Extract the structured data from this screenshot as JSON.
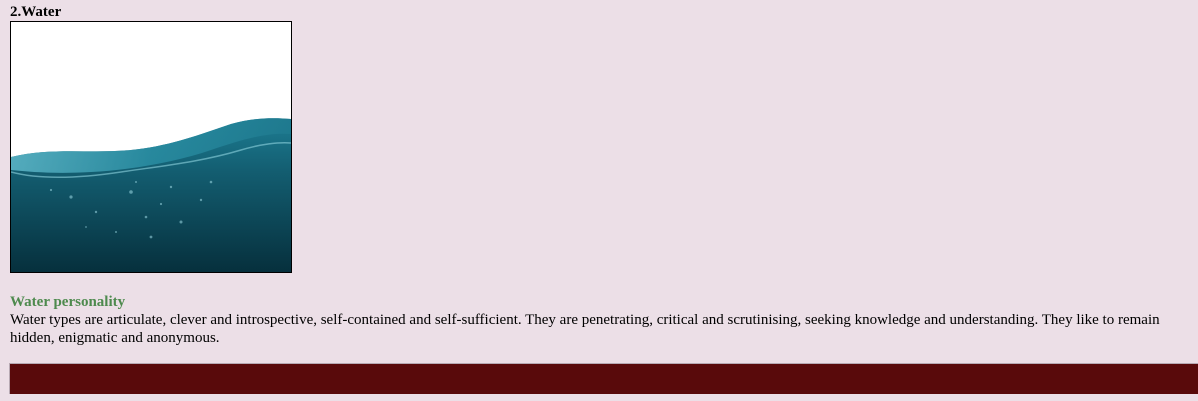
{
  "section": {
    "title": "2.Water"
  },
  "image": {
    "description_icon": "water-wave-image"
  },
  "content": {
    "subtitle": "Water personality",
    "paragraph": "Water types are articulate, clever and introspective, self-contained and self-sufficient. They are penetrating, critical and scrutinising, seeking knowledge and understanding. They like to remain hidden, enigmatic and anonymous."
  },
  "colors": {
    "background": "#ecdfe7",
    "subtitle": "#4e8a4e",
    "bar": "#590a0b",
    "water_deep": "#0b3a4a",
    "water_light": "#2a8ea3"
  }
}
